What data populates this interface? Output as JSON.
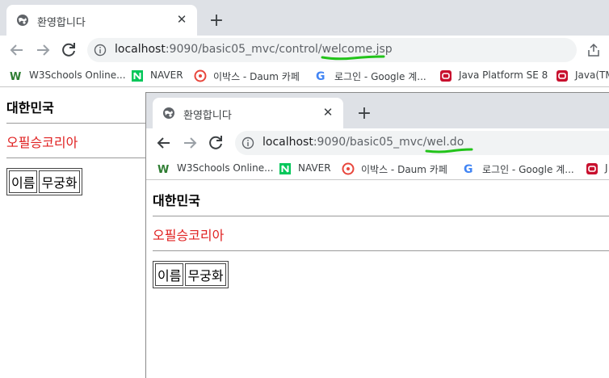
{
  "back": {
    "tab": {
      "title": "환영합니다"
    },
    "address": {
      "host": "localhost",
      "path_pre": ":9090/basic05_mvc/control/",
      "path_hl": "welcome.jsp"
    },
    "bookmarks": [
      {
        "label": "W3Schools Online..."
      },
      {
        "label": "NAVER"
      },
      {
        "label": "이박스 - Daum 카페"
      },
      {
        "label": "로그인 - Google 계..."
      },
      {
        "label": "Java Platform SE 8"
      },
      {
        "label": "Java(TM"
      }
    ],
    "content": {
      "heading": "대한민국",
      "red_text": "오필승코리아",
      "cell1": "이름",
      "cell2": "무궁화"
    }
  },
  "front": {
    "tab": {
      "title": "환영합니다"
    },
    "address": {
      "host": "localhost",
      "path_pre": ":9090/basic05_mvc/",
      "path_hl": "wel.do"
    },
    "bookmarks": [
      {
        "label": "W3Schools Online..."
      },
      {
        "label": "NAVER"
      },
      {
        "label": "이박스 - Daum 카페"
      },
      {
        "label": "로그인 - Google 계..."
      },
      {
        "label": "J"
      }
    ],
    "content": {
      "heading": "대한민국",
      "red_text": "오필승코리아",
      "cell1": "이름",
      "cell2": "무궁화"
    }
  },
  "colors": {
    "annotation": "#22c31a",
    "red_text": "#e02020",
    "naver": "#03c75a",
    "java": "#c8102e",
    "daum": "#e8463c"
  },
  "icons": [
    "globe-icon",
    "close-icon",
    "plus-icon",
    "back-arrow-icon",
    "forward-arrow-icon",
    "reload-icon",
    "info-icon",
    "share-icon",
    "w3schools-icon",
    "naver-icon",
    "daum-icon",
    "google-icon",
    "java-icon"
  ]
}
